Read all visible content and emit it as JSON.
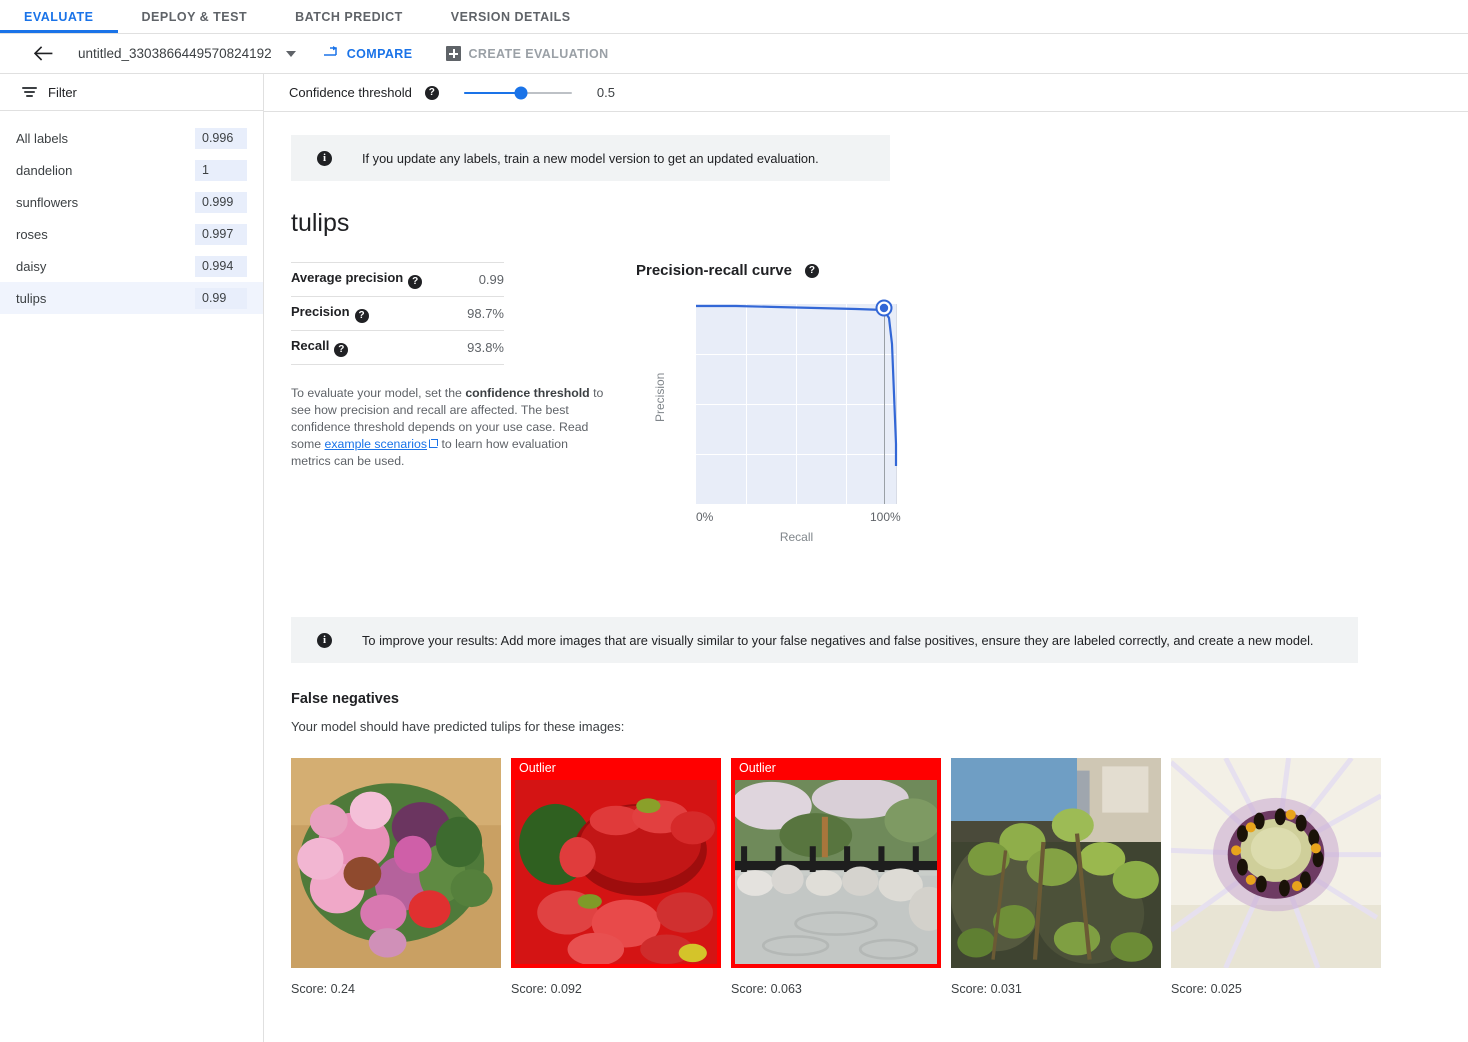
{
  "tabs": [
    {
      "label": "EVALUATE",
      "active": true
    },
    {
      "label": "DEPLOY & TEST",
      "active": false
    },
    {
      "label": "BATCH PREDICT",
      "active": false
    },
    {
      "label": "VERSION DETAILS",
      "active": false
    }
  ],
  "actionbar": {
    "back_icon": "arrow-left-icon",
    "model_name": "untitled_3303866449570824192",
    "compare_label": "COMPARE",
    "create_evaluation_label": "CREATE EVALUATION"
  },
  "sidebar": {
    "filter_label": "Filter",
    "labels": [
      {
        "name": "All labels",
        "score": "0.996",
        "selected": false
      },
      {
        "name": "dandelion",
        "score": "1",
        "selected": false
      },
      {
        "name": "sunflowers",
        "score": "0.999",
        "selected": false
      },
      {
        "name": "roses",
        "score": "0.997",
        "selected": false
      },
      {
        "name": "daisy",
        "score": "0.994",
        "selected": false
      },
      {
        "name": "tulips",
        "score": "0.99",
        "selected": true
      }
    ]
  },
  "threshold": {
    "label": "Confidence threshold",
    "value": "0.5",
    "help": "?"
  },
  "banners": {
    "top": "If you update any labels, train a new model version to get an updated evaluation.",
    "bottom": "To improve your results: Add more images that are visually similar to your false negatives and false positives, ensure they are labeled correctly, and create a new model."
  },
  "detail": {
    "title": "tulips",
    "metrics": [
      {
        "name": "Average precision",
        "value": "0.99"
      },
      {
        "name": "Precision",
        "value": "98.7%"
      },
      {
        "name": "Recall",
        "value": "93.8%"
      }
    ],
    "description_part1": "To evaluate your model, set the ",
    "description_bold": "confidence threshold",
    "description_part2": " to see how precision and recall are affected. The best confidence threshold depends on your use case. Read some ",
    "description_link": "example scenarios",
    "description_part3": " to learn how evaluation metrics can be used."
  },
  "chart_data": {
    "type": "line",
    "title": "Precision-recall curve",
    "xlabel": "Recall",
    "ylabel": "Precision",
    "xlim": [
      0,
      100
    ],
    "ylim": [
      0,
      100
    ],
    "x_ticks": [
      "0%",
      "100%"
    ],
    "grid": true,
    "legend": "none",
    "marker_point": {
      "x": 93.8,
      "y": 98.7,
      "label": "current threshold 0.5"
    },
    "series": [
      {
        "name": "tulips precision-recall",
        "x": [
          0,
          20,
          40,
          60,
          80,
          93.8,
          96,
          97.5,
          98.5,
          99.5,
          100
        ],
        "y": [
          99.5,
          99.5,
          99.4,
          99.2,
          99.0,
          98.7,
          95.0,
          85.0,
          65.0,
          40.0,
          25.0
        ]
      }
    ]
  },
  "false_negatives": {
    "title": "False negatives",
    "subtitle": "Your model should have predicted tulips for these images:",
    "outlier_label": "Outlier",
    "items": [
      {
        "score_label": "Score: 0.24",
        "outlier": false,
        "alt": "bouquet of pink and purple tulips and ranunculus on wood table"
      },
      {
        "score_label": "Score: 0.092",
        "outlier": true,
        "alt": "red colander full of strawberries"
      },
      {
        "score_label": "Score: 0.063",
        "outlier": true,
        "alt": "japanese garden pond with rocks and black railing"
      },
      {
        "score_label": "Score: 0.031",
        "outlier": false,
        "alt": "green leafy weeds growing on mossy rock"
      },
      {
        "score_label": "Score: 0.025",
        "outlier": false,
        "alt": "closeup of white daisy flower center"
      }
    ]
  },
  "colors": {
    "accent": "#1a73e8",
    "outlier": "#ff0000",
    "plot_fill": "#e8edf8",
    "text_secondary": "#5f6368"
  }
}
